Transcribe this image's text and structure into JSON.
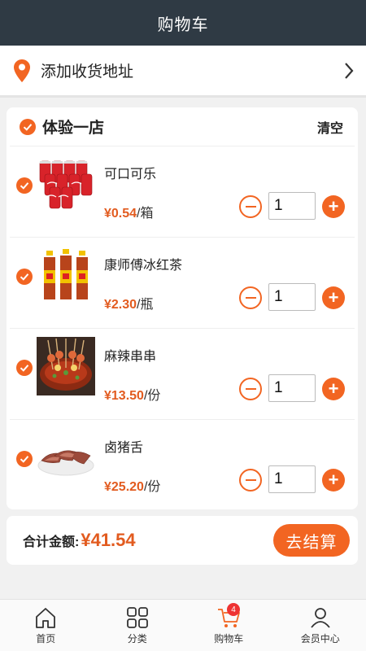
{
  "header": {
    "title": "购物车"
  },
  "address": {
    "label": "添加收货地址"
  },
  "store": {
    "name": "体验一店",
    "clear_label": "清空"
  },
  "items": [
    {
      "name": "可口可乐",
      "price": "¥0.54",
      "unit": "/箱",
      "qty": "1"
    },
    {
      "name": "康师傅冰红茶",
      "price": "¥2.30",
      "unit": "/瓶",
      "qty": "1"
    },
    {
      "name": "麻辣串串",
      "price": "¥13.50",
      "unit": "/份",
      "qty": "1"
    },
    {
      "name": "卤猪舌",
      "price": "¥25.20",
      "unit": "/份",
      "qty": "1"
    }
  ],
  "footer": {
    "total_label": "合计金额:",
    "total_amount": "¥41.54",
    "checkout_label": "去结算"
  },
  "tabbar": {
    "tabs": [
      {
        "label": "首页",
        "icon": "home-icon"
      },
      {
        "label": "分类",
        "icon": "category-icon"
      },
      {
        "label": "购物车",
        "icon": "cart-icon",
        "badge": "4"
      },
      {
        "label": "会员中心",
        "icon": "user-icon"
      }
    ]
  },
  "colors": {
    "accent": "#f26522",
    "header_bg": "#2f3a44",
    "price": "#e25b1f"
  }
}
